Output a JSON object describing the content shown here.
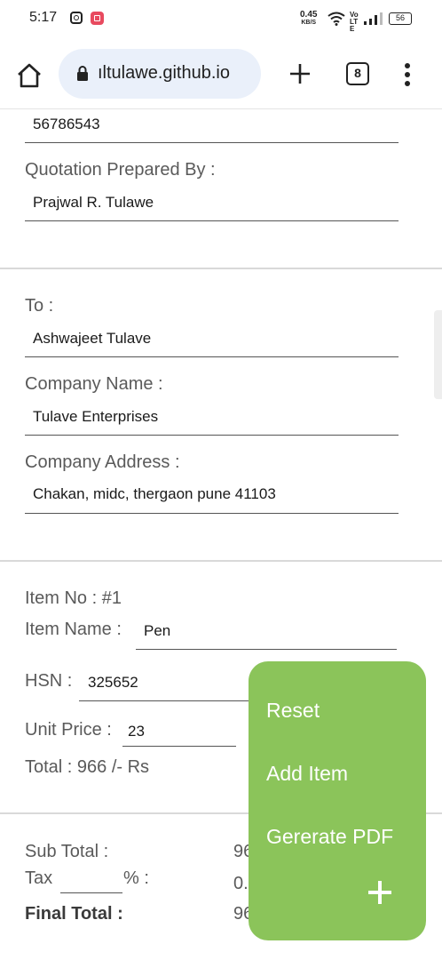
{
  "status_bar": {
    "time": "5:17",
    "net_speed_value": "0.45",
    "net_speed_unit": "KB/S",
    "volte": "Vo LTE",
    "battery": "56"
  },
  "browser": {
    "url": "ıltulawe.github.io",
    "tab_count": "8",
    "icons": [
      "home-icon",
      "lock-icon",
      "new-tab-icon",
      "tabs-icon",
      "more-menu-icon"
    ]
  },
  "sender": {
    "phone_value": "56786543",
    "prepared_by_label": "Quotation Prepared By :",
    "prepared_by_value": "Prajwal R. Tulawe"
  },
  "recipient": {
    "to_label": "To :",
    "to_value": "Ashwajeet Tulave",
    "company_name_label": "Company Name :",
    "company_name_value": "Tulave Enterprises",
    "company_address_label": "Company Address :",
    "company_address_value": "Chakan, midc, thergaon pune 41103"
  },
  "item": {
    "item_no": "Item No : #1",
    "item_name_label": "Item Name :",
    "item_name_value": "Pen",
    "hsn_label": "HSN :",
    "hsn_value": "325652",
    "unit_price_label": "Unit Price :",
    "unit_price_value": "23",
    "total": "Total : 966 /- Rs"
  },
  "summary": {
    "sub_total_label": "Sub Total :",
    "sub_total_value": "96",
    "tax_label": "Tax",
    "tax_percent": "% :",
    "tax_value": "0.",
    "final_total_label": "Final Total :",
    "final_total_value": "96"
  },
  "fab_menu": {
    "reset": "Reset",
    "add_item": "Add Item",
    "generate_pdf": "Gererate PDF",
    "color": "#8bc45a"
  }
}
